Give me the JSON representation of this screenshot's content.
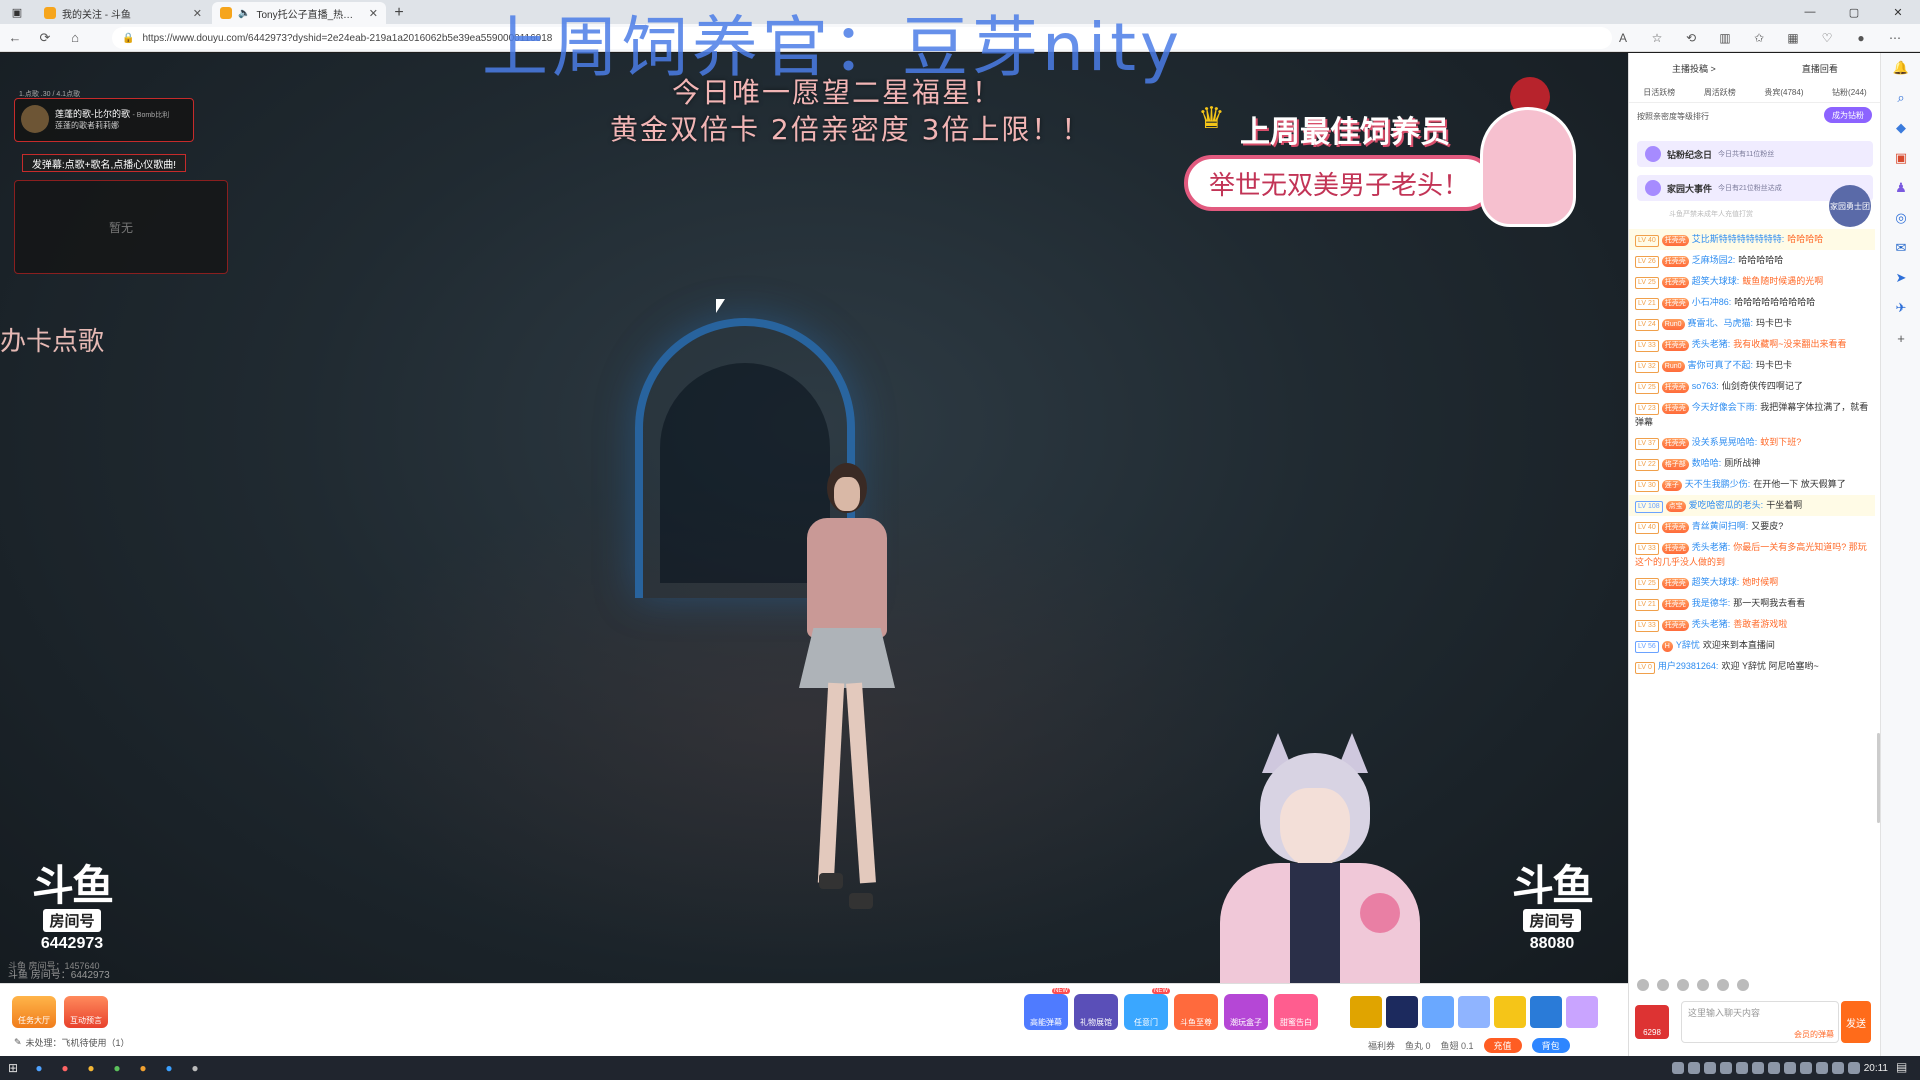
{
  "browser": {
    "tabs": [
      {
        "label": "我的关注 - 斗鱼",
        "active": false
      },
      {
        "label": "Tony托公子直播_热门游戏直",
        "active": true
      }
    ],
    "url": "https://www.douyu.com/6442973?dyshid=2e24eab-219a1a2016062b5e39ea5590000116018",
    "window_controls": {
      "minimize": "—",
      "maximize": "▢",
      "close": "✕"
    }
  },
  "overlay": {
    "title": "上周饲养官：豆芽nity"
  },
  "video": {
    "headline1": "今日唯一愿望二星福星！",
    "headline2": "黄金双倍卡   2倍亲密度   3倍上限！！",
    "best_feeder_title": "上周最佳饲养员",
    "best_feeder_name": "举世无双美男子老头！",
    "song_widget": {
      "song_top": "1.点歌 .30  /  4.1点歌",
      "song_title": "莲蓬的歌-比尔的歌",
      "song_artist": "- Bomb比利",
      "song_sub": "莲蓬的歌者莉莉娜",
      "hint": "发弹幕:点歌+歌名,点播心仪歌曲!",
      "empty": "暂无"
    },
    "card_song": "办卡点歌",
    "logo_left": {
      "mark": "斗鱼",
      "label": "房间号",
      "room": "6442973"
    },
    "logo_right": {
      "mark": "斗鱼",
      "label": "房间号",
      "room": "88080"
    },
    "watermark_top": "斗鱼 房间号：1457640",
    "watermark_bottom": "斗鱼 房间号：6442973"
  },
  "giftbar": {
    "left_items": [
      {
        "label": "任务大厅",
        "style": "orange"
      },
      {
        "label": "互动预言",
        "style": "red"
      }
    ],
    "pending": "未处理：飞机待使用（1）",
    "gifts": [
      {
        "label": "高能弹幕",
        "color": "#4f7bff",
        "new": true
      },
      {
        "label": "礼物展馆",
        "color": "#5a4fb8",
        "new": false
      },
      {
        "label": "任意门",
        "color": "#3aa7ff",
        "new": true
      },
      {
        "label": "斗鱼至尊",
        "color": "#ff6a3d",
        "new": false
      },
      {
        "label": "潮玩盒子",
        "color": "#b547d6",
        "new": false
      },
      {
        "label": "甜蜜告白",
        "color": "#ff5d8f",
        "new": false
      }
    ],
    "new_tag": "NEW",
    "item_colors": [
      "#e0a400",
      "#1c2a5e",
      "#6aa8ff",
      "#8fb4ff",
      "#f5c518",
      "#2a7bd8",
      "#c9a4ff"
    ],
    "wallet": {
      "benefits": "福利券",
      "yuwan": "鱼丸 0",
      "yuchi": "鱼翅 0.1",
      "charge": "充值",
      "bag": "背包"
    }
  },
  "chat": {
    "rank_top": [
      "主播投稿 >",
      "直播回看"
    ],
    "rank_tabs": [
      "日活跃榜",
      "周活跃榜",
      "贵宾(4784)",
      "钻粉(244)"
    ],
    "rank_note": "按照亲密度等级排行",
    "rank_button": "成为钻粉",
    "notice1": {
      "title": "钻粉纪念日",
      "sub": "今日共有11位粉丝"
    },
    "notice2": {
      "title": "家园大事件",
      "sub": "今日有21位粉丝达成"
    },
    "fans_badge": "家园勇士团",
    "minor_notice": "斗鱼严禁未成年人充值打赏",
    "messages": [
      {
        "lv": "LV 40",
        "badge": "托壳壳",
        "user": "艾比斯特特特特特特特:",
        "text": "哈哈哈哈",
        "hl": true,
        "orange": true
      },
      {
        "lv": "LV 26",
        "badge": "托壳壳",
        "user": "乏麻场园2:",
        "text": "哈哈哈哈哈",
        "hl": false,
        "orange": false
      },
      {
        "lv": "LV 25",
        "badge": "托壳壳",
        "user": "超笑大球球:",
        "text": "鲅鱼随时候遇的光啊",
        "hl": false,
        "orange": true
      },
      {
        "lv": "LV 21",
        "badge": "托壳壳",
        "user": "小石冲86:",
        "text": "哈哈哈哈哈哈哈哈哈",
        "hl": false,
        "orange": false
      },
      {
        "lv": "LV 24",
        "badge": "Run0",
        "user": "赛雷北、马虎猫:",
        "text": "玛卡巴卡",
        "hl": false,
        "orange": false
      },
      {
        "lv": "LV 33",
        "badge": "托壳壳",
        "user": "秃头老猪:",
        "text": "我有收藏啊~没来翻出来看看",
        "hl": false,
        "orange": true
      },
      {
        "lv": "LV 32",
        "badge": "Run0",
        "user": "害你可真了不起:",
        "text": "玛卡巴卡",
        "hl": false,
        "orange": false
      },
      {
        "lv": "LV 25",
        "badge": "托壳壳",
        "user": "so763:",
        "text": "仙剑奇侠传四啊记了",
        "hl": false,
        "orange": false
      },
      {
        "lv": "LV 23",
        "badge": "托壳壳",
        "user": "今天好像会下雨:",
        "text": "我把弹幕字体拉满了，就看弹幕",
        "hl": false,
        "orange": false
      },
      {
        "lv": "LV 37",
        "badge": "托壳壳",
        "user": "没关系晃晃哈哈:",
        "text": "蚊到下班?",
        "hl": false,
        "orange": true
      },
      {
        "lv": "LV 22",
        "badge": "格子部",
        "user": "数哈哈:",
        "text": "厕所战神",
        "hl": false,
        "orange": false
      },
      {
        "lv": "LV 30",
        "badge": "莲子",
        "user": "天不生我鹏少伤:",
        "text": "在开他一下 放天假算了",
        "hl": false,
        "orange": false
      },
      {
        "lv": "LV 108",
        "badge": "点宝",
        "user": "爱吃哈密瓜的老头:",
        "text": "干坐着啊",
        "hl": true,
        "orange": false
      },
      {
        "lv": "LV 40",
        "badge": "托壳壳",
        "user": "青丝黄间扫啊:",
        "text": "又要皮?",
        "hl": false,
        "orange": false
      },
      {
        "lv": "LV 33",
        "badge": "托壳壳",
        "user": "秃头老猪:",
        "text": "你最后一关有多高光知道吗? 那玩这个的几乎没人做的到",
        "hl": false,
        "orange": true
      },
      {
        "lv": "LV 25",
        "badge": "托壳壳",
        "user": "超笑大球球:",
        "text": "她时候啊",
        "hl": false,
        "orange": true
      },
      {
        "lv": "LV 21",
        "badge": "托壳壳",
        "user": "我是德华:",
        "text": "那一天啊我去看看",
        "hl": false,
        "orange": false
      },
      {
        "lv": "LV 33",
        "badge": "托壳壳",
        "user": "秃头老猪:",
        "text": "善敢者游戏啦",
        "hl": false,
        "orange": true
      },
      {
        "lv": "LV 56",
        "badge": "H",
        "user": "Y辞忧",
        "text": "欢迎来到本直播间",
        "hl": false,
        "orange": false
      },
      {
        "lv": "LV 0",
        "badge": "",
        "user": "用户29381264:",
        "text": "欢迎 Y辞忧 阿尼哈塞哟~",
        "hl": false,
        "orange": false
      }
    ],
    "input_placeholder": "这里输入聊天内容",
    "input_barrage": "会员的弹幕",
    "send_button": "发送",
    "avatar_label": "6298"
  },
  "taskbar": {
    "clock": "20:11"
  }
}
